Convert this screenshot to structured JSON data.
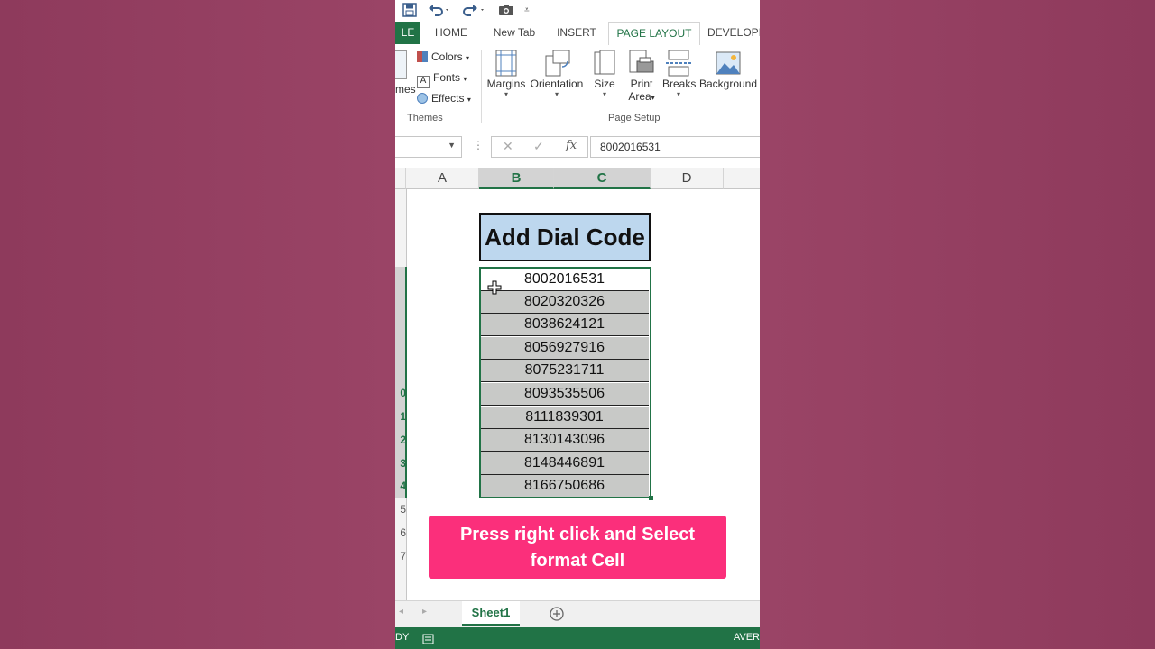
{
  "tabs": {
    "file": "LE",
    "home": "HOME",
    "new_tab": "New Tab",
    "insert": "INSERT",
    "page_layout": "PAGE LAYOUT",
    "developer": "DEVELOPE"
  },
  "ribbon": {
    "themes_label": "mes",
    "colors": "Colors",
    "fonts": "Fonts",
    "effects": "Effects",
    "themes_group": "Themes",
    "margins": "Margins",
    "orientation": "Orientation",
    "size": "Size",
    "print_area_1": "Print",
    "print_area_2": "Area",
    "breaks": "Breaks",
    "background": "Background",
    "page_setup_group": "Page Setup"
  },
  "formula_bar": {
    "fx": "fx",
    "value": "8002016531"
  },
  "columns": [
    "A",
    "B",
    "C",
    "D"
  ],
  "row_headers": [
    "0",
    "1",
    "2",
    "3",
    "4",
    "5",
    "6",
    "7"
  ],
  "sheet": {
    "title": "Add Dial Code",
    "numbers": [
      "8002016531",
      "8020320326",
      "8038624121",
      "8056927916",
      "8075231711",
      "8093535506",
      "8111839301",
      "8130143096",
      "8148446891",
      "8166750686"
    ]
  },
  "callout": {
    "line1": "Press right click and Select",
    "line2": "format Cell"
  },
  "sheet_tabs": {
    "active": "Sheet1"
  },
  "status": {
    "left": "DY",
    "right": "AVER"
  },
  "colors": {
    "excel_green": "#217346",
    "title_fill": "#bdd7ee",
    "row_fill": "#c8c9c7",
    "callout": "#fb2f7b",
    "background": "#953f61"
  }
}
